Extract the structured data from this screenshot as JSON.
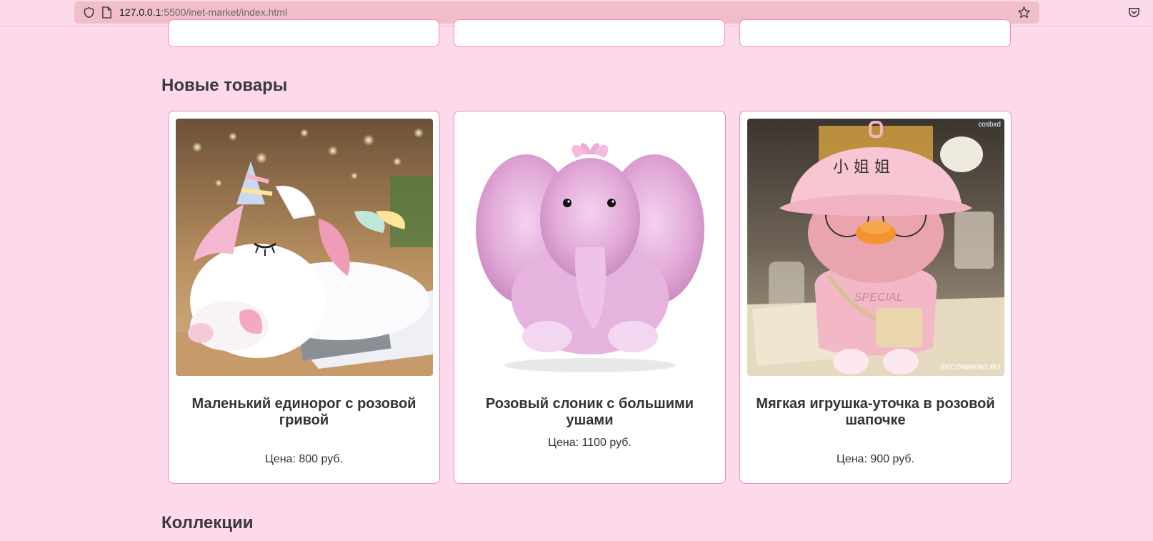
{
  "browser": {
    "url_host": "127.0.0.1",
    "url_rest": ":5500/inet-market/index.html"
  },
  "sections": {
    "new_products_title": "Новые товары",
    "collections_title": "Коллекции"
  },
  "products": [
    {
      "title": "Маленький единорог с розовой гривой",
      "price": "Цена: 800 руб.",
      "image": "white-unicorn-plush"
    },
    {
      "title": "Розовый слоник с большими ушами",
      "price": "Цена: 1100 руб.",
      "image": "pink-elephant-plush"
    },
    {
      "title": "Мягкая игрушка-уточка в розовой шапочке",
      "price": "Цена: 900 руб.",
      "image": "duck-plush-pink-hat",
      "watermark": "cosbxd",
      "credit": "RECOMMEND.RU"
    }
  ],
  "colors": {
    "page_bg": "#fdd9ec",
    "card_border": "#f08bb2",
    "url_bar": "#f0bdc8"
  }
}
